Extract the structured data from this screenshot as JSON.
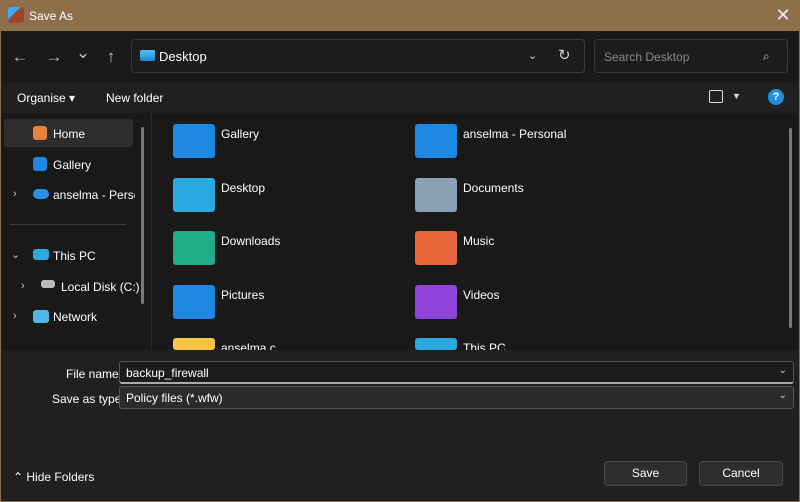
{
  "window": {
    "title": "Save As",
    "close_icon": "close-icon"
  },
  "nav": {
    "back": "←",
    "forward": "→",
    "recent": "⌄",
    "up": "↑",
    "address": "Desktop",
    "refresh": "↻",
    "search_placeholder": "Search Desktop"
  },
  "toolbar": {
    "organise": "Organise ▾",
    "new_folder": "New folder",
    "help": "?"
  },
  "sidebar": {
    "items": [
      {
        "label": "Home"
      },
      {
        "label": "Gallery"
      },
      {
        "label": "anselma - Personal"
      },
      {
        "label": "This PC"
      },
      {
        "label": "Local Disk (C:)"
      },
      {
        "label": "Network"
      }
    ]
  },
  "items": [
    {
      "label": "Gallery",
      "color": "#1e88e5"
    },
    {
      "label": "anselma - Personal",
      "color": "#1e88e5"
    },
    {
      "label": "Desktop",
      "color": "#29a9e0"
    },
    {
      "label": "Documents",
      "color": "#8aa0b4"
    },
    {
      "label": "Downloads",
      "color": "#1fae87"
    },
    {
      "label": "Music",
      "color": "#e8673a"
    },
    {
      "label": "Pictures",
      "color": "#1e88e5"
    },
    {
      "label": "Videos",
      "color": "#8e44d8"
    },
    {
      "label": "anselma.c",
      "color": "#f5c542"
    },
    {
      "label": "This PC",
      "color": "#29a9e0"
    }
  ],
  "form": {
    "file_name_label": "File name:",
    "file_name": "backup_firewall",
    "type_label": "Save as type:",
    "type": "Policy files (*.wfw)"
  },
  "footer": {
    "hide_folders": "Hide Folders",
    "save": "Save",
    "cancel": "Cancel"
  }
}
